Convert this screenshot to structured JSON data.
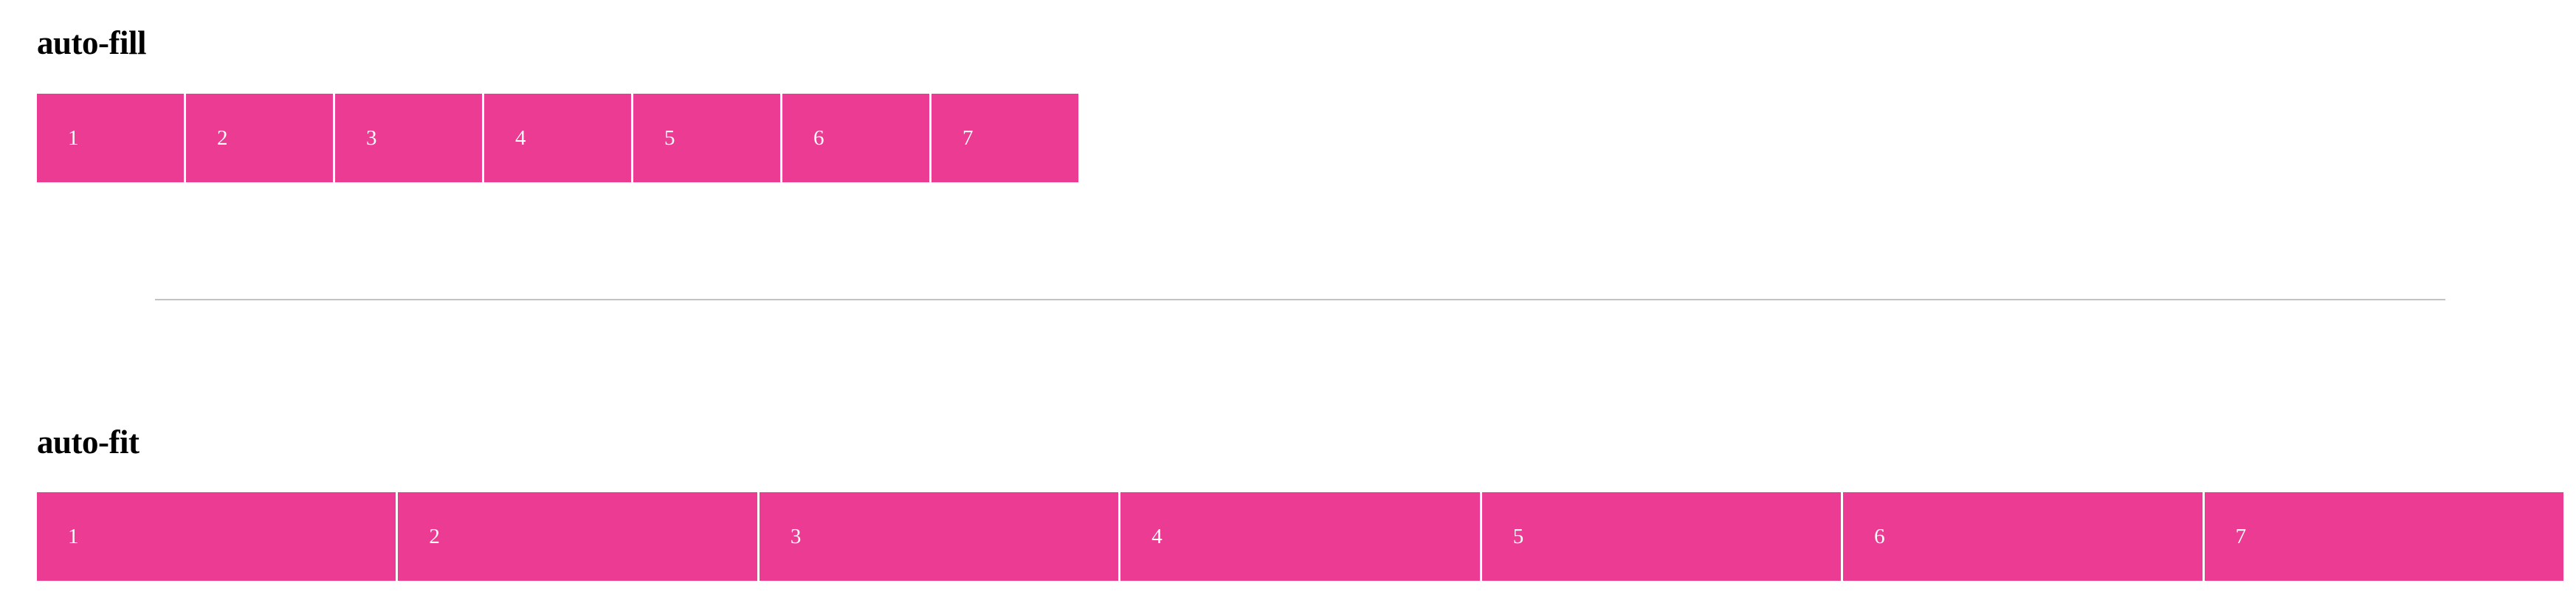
{
  "sections": {
    "fill": {
      "title": "auto-fill",
      "items": [
        "1",
        "2",
        "3",
        "4",
        "5",
        "6",
        "7"
      ]
    },
    "fit": {
      "title": "auto-fit",
      "items": [
        "1",
        "2",
        "3",
        "4",
        "5",
        "6",
        "7"
      ]
    }
  },
  "colors": {
    "cell_background": "#eb3b92",
    "cell_text": "#ffffff",
    "divider": "#c2c2c2"
  }
}
